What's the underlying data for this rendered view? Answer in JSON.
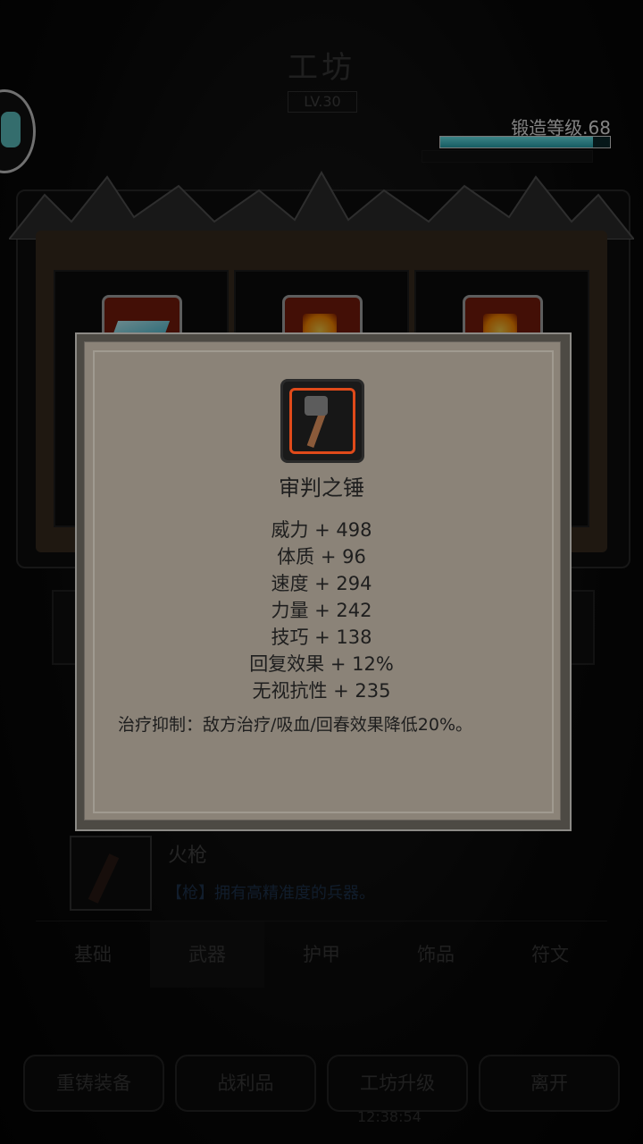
{
  "header": {
    "title": "工坊",
    "level": "LV.30",
    "forge_label": "锻造等级.68",
    "forge_progress": 0.9
  },
  "item_list": {
    "name": "火枪",
    "desc": "【枪】拥有高精准度的兵器。"
  },
  "tabs": [
    {
      "label": "基础"
    },
    {
      "label": "武器"
    },
    {
      "label": "护甲"
    },
    {
      "label": "饰品"
    },
    {
      "label": "符文"
    }
  ],
  "active_tab": "武器",
  "buttons": [
    {
      "label": "重铸装备"
    },
    {
      "label": "战利品"
    },
    {
      "label": "工坊升级"
    },
    {
      "label": "离开"
    }
  ],
  "clock": "12:38:54",
  "tooltip": {
    "item_name": "审判之锤",
    "stats": [
      "威力 + 498",
      "体质 + 96",
      "速度 + 294",
      "力量 + 242",
      "技巧 + 138",
      "回复效果 + 12%",
      "无视抗性 + 235"
    ],
    "effect": "治疗抑制：敌方治疗/吸血/回春效果降低20%。"
  },
  "colors": {
    "forge_bar": "#4fdde6",
    "popup_bg": "#8b8378",
    "icon_border": "#e04a1a"
  }
}
